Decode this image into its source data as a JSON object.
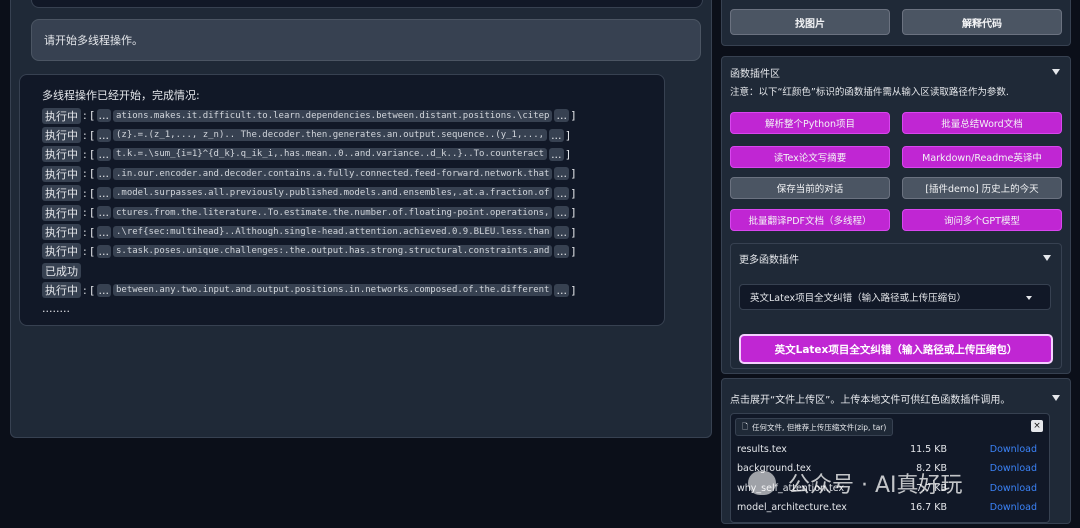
{
  "chat": {
    "user_message": "请开始多线程操作。",
    "bot_title": "多线程操作已经开始，完成情况:",
    "tasks": [
      {
        "status": "执行中",
        "snippet": "ations.makes.it.difficult.to.learn.dependencies.between.distant.positions.\\citep"
      },
      {
        "status": "执行中",
        "snippet": "(z}.=.(z_1,..., z_n).. The.decoder.then.generates.an.output.sequence..(y_1,...,"
      },
      {
        "status": "执行中",
        "snippet": "t.k.=.\\sum_{i=1}^{d_k}.q_ik_i,.has.mean..0..and.variance..d_k..}..To.counteract"
      },
      {
        "status": "执行中",
        "snippet": ".in.our.encoder.and.decoder.contains.a.fully.connected.feed-forward.network.that"
      },
      {
        "status": "执行中",
        "snippet": ".model.surpasses.all.previously.published.models.and.ensembles,.at.a.fraction.of"
      },
      {
        "status": "执行中",
        "snippet": "ctures.from.the.literature..To.estimate.the.number.of.floating-point.operations,"
      },
      {
        "status": "执行中",
        "snippet": ".\\ref{sec:multihead}..Although.single-head.attention.achieved.0.9.BLEU.less.than"
      },
      {
        "status": "执行中",
        "snippet": "s.task.poses.unique.challenges:.the.output.has.strong.structural.constraints.and"
      },
      {
        "status": "已成功",
        "snippet": ""
      },
      {
        "status": "执行中",
        "snippet": "between.any.two.input.and.output.positions.in.networks.composed.of.the.different"
      }
    ],
    "trailing_dots": "........",
    "ellipsis": "..."
  },
  "toolbar": {
    "find_image": "找图片",
    "explain_code": "解释代码"
  },
  "plugins": {
    "header": "函数插件区",
    "note": "注意：以下“红颜色”标识的函数插件需从输入区读取路径作为参数.",
    "buttons": [
      {
        "label": "解析整个Python项目",
        "color": "purple"
      },
      {
        "label": "批量总结Word文档",
        "color": "purple"
      },
      {
        "label": "读Tex论文写摘要",
        "color": "purple"
      },
      {
        "label": "Markdown/Readme英译中",
        "color": "purple"
      },
      {
        "label": "保存当前的对话",
        "color": "gray"
      },
      {
        "label": "[插件demo] 历史上的今天",
        "color": "gray"
      },
      {
        "label": "批量翻译PDF文档（多线程）",
        "color": "purple"
      },
      {
        "label": "询问多个GPT模型",
        "color": "purple"
      }
    ],
    "more_header": "更多函数插件",
    "dropdown_value": "英文Latex项目全文纠错（输入路径或上传压缩包）",
    "run_button": "英文Latex项目全文纠错（输入路径或上传压缩包）"
  },
  "upload": {
    "header": "点击展开“文件上传区”。上传本地文件可供红色函数插件调用。",
    "hint": "任何文件, 但推荐上传压缩文件(zip, tar)",
    "close": "×",
    "files": [
      {
        "name": "results.tex",
        "size": "11.5 KB",
        "action": "Download"
      },
      {
        "name": "background.tex",
        "size": "8.2 KB",
        "action": "Download"
      },
      {
        "name": "why_self_attention.tex",
        "size": "7.7 KB",
        "action": "Download"
      },
      {
        "name": "model_architecture.tex",
        "size": "16.7 KB",
        "action": "Download"
      }
    ]
  },
  "watermark": "公众号 · AI真好玩"
}
